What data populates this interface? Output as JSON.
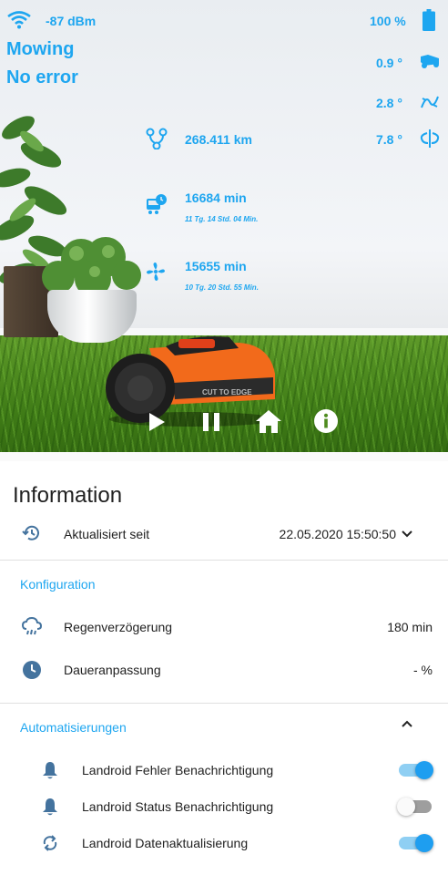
{
  "status": {
    "signal": "-87 dBm",
    "battery": "100 %",
    "state": "Mowing",
    "error": "No error",
    "pitch": "0.9 °",
    "roll": "2.8 °",
    "yaw": "7.8 °",
    "distance": "268.411 km",
    "blade_time": "16684 min",
    "blade_time_detail": "11 Tg. 14 Std. 04 Min.",
    "work_time": "15655 min",
    "work_time_detail": "10 Tg. 20 Std. 55 Min.",
    "mower_brand_text": "CUT TO EDGE"
  },
  "controls": [
    "play",
    "pause",
    "home",
    "info"
  ],
  "info": {
    "title": "Information",
    "updated_label": "Aktualisiert seit",
    "updated_value": "22.05.2020 15:50:50",
    "config_title": "Konfiguration",
    "rain_label": "Regenverzögerung",
    "rain_value": "180 min",
    "time_label": "Daueranpassung",
    "time_value": "- %",
    "auto_title": "Automatisierungen",
    "automations": [
      {
        "label": "Landroid Fehler Benachrichtigung",
        "on": true
      },
      {
        "label": "Landroid Status Benachrichtigung",
        "on": false
      },
      {
        "label": "Landroid Datenaktualisierung",
        "on": true
      }
    ]
  },
  "colors": {
    "accent": "#1ea6f0",
    "icon_dark": "#44739e",
    "mower": "#f26a1b"
  }
}
